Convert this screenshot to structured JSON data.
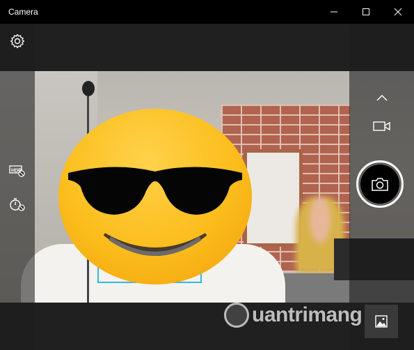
{
  "window": {
    "title": "Camera",
    "controls": {
      "minimize": "minimize-icon",
      "maximize": "maximize-icon",
      "close": "close-icon"
    }
  },
  "toolbar_left": [
    {
      "id": "settings",
      "icon": "gear-icon"
    },
    {
      "id": "hdr",
      "icon": "hdr-off-icon"
    },
    {
      "id": "timer",
      "icon": "timer-off-icon"
    }
  ],
  "toolbar_right": [
    {
      "id": "collapse",
      "icon": "chevron-up-icon"
    },
    {
      "id": "video-mode",
      "icon": "video-camera-icon"
    },
    {
      "id": "take-photo",
      "icon": "camera-icon"
    },
    {
      "id": "camera-roll",
      "icon": "photo-thumbnail-icon"
    }
  ],
  "viewfinder": {
    "overlay": "sunglasses-emoji",
    "face_detection": true
  },
  "watermark": {
    "text": "uantrimang"
  },
  "colors": {
    "face_box": "#2fb7e5",
    "emoji_yellow": "#fbbd1c",
    "chrome": "#000000"
  }
}
